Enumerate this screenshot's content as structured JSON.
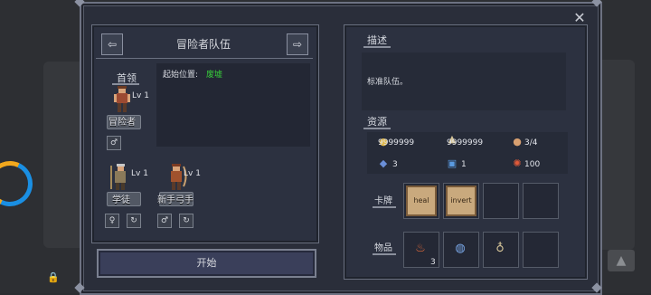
{
  "header": {
    "title": "冒险者队伍",
    "prev_arrow": "⇦",
    "next_arrow": "⇨",
    "close": "✕"
  },
  "leader": {
    "section_label": "首领",
    "start_position_label": "起始位置:",
    "start_position_value": "废墟",
    "hero": {
      "name": "冒险者",
      "level": "Lv 1",
      "gender": "♂"
    }
  },
  "members": [
    {
      "name": "学徒",
      "level": "Lv 1",
      "gender": "♀",
      "swap": "↻"
    },
    {
      "name": "新手弓手",
      "level": "Lv 1",
      "gender": "♂",
      "swap": "↻"
    }
  ],
  "start_button": "开始",
  "description": {
    "label": "描述",
    "text": "标准队伍。"
  },
  "resources": {
    "label": "资源",
    "gold": "9999999",
    "supplies": "9999999",
    "party_size": "3/4",
    "gems": "3",
    "scrolls": "1",
    "morale": "100"
  },
  "cards": {
    "label": "卡牌",
    "slots": [
      "heal",
      "invert",
      "",
      ""
    ]
  },
  "items": {
    "label": "物品",
    "slots": [
      {
        "icon": "potion-icon",
        "count": "3"
      },
      {
        "icon": "orb-icon",
        "count": ""
      },
      {
        "icon": "pouch-icon",
        "count": ""
      },
      {
        "icon": "",
        "count": ""
      }
    ]
  },
  "background": {
    "chip": "▲",
    "lock": "🔒"
  }
}
